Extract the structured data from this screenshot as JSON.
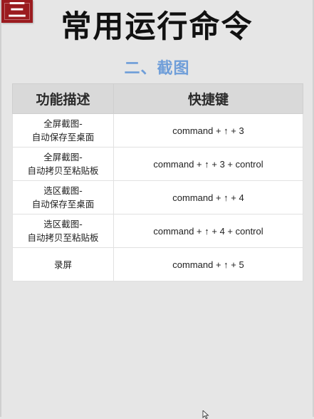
{
  "badge": {
    "text": "三"
  },
  "title": "常用运行命令",
  "section_title": "二、截图",
  "table": {
    "headers": [
      "功能描述",
      "快捷键"
    ],
    "rows": [
      {
        "desc_line1": "全屏截图-",
        "desc_line2": "自动保存至桌面",
        "shortcut": "command + ↑ + 3"
      },
      {
        "desc_line1": "全屏截图-",
        "desc_line2": "自动拷贝至粘贴板",
        "shortcut": "command + ↑ + 3 + control"
      },
      {
        "desc_line1": "选区截图-",
        "desc_line2": "自动保存至桌面",
        "shortcut": "command + ↑ + 4"
      },
      {
        "desc_line1": "选区截图-",
        "desc_line2": "自动拷贝至粘贴板",
        "shortcut": "command + ↑ + 4 + control"
      },
      {
        "desc_line1": "录屏",
        "desc_line2": "",
        "shortcut": "command + ↑ + 5"
      }
    ]
  },
  "colors": {
    "badge": "#9b1b1f",
    "section_title": "#6f9ed9",
    "header_bg": "#d9d9d9",
    "page_bg": "#e6e6e6"
  },
  "icons": {
    "cursor": "mouse-pointer-icon"
  }
}
